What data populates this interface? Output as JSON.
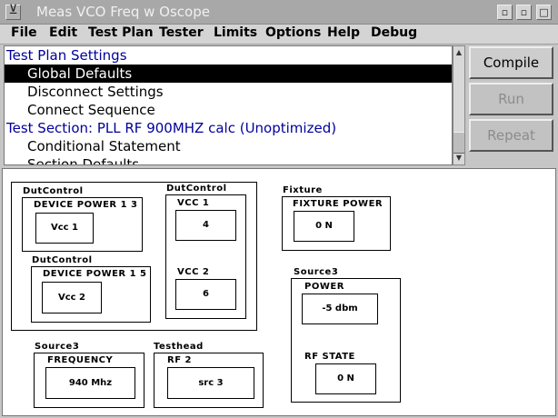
{
  "window": {
    "title": "Meas VCO Freq w Oscope",
    "sys_glyph": "⊻",
    "min_glyph": "▫",
    "max_glyph": "□"
  },
  "menubar": {
    "items": [
      "File",
      "Edit",
      "Test Plan",
      "Tester",
      "Limits",
      "Options",
      "Help",
      "Debug"
    ]
  },
  "tree": {
    "rows": [
      {
        "label": "Test Plan Settings",
        "kind": "head"
      },
      {
        "label": "Global Defaults",
        "kind": "child",
        "selected": true
      },
      {
        "label": "Disconnect Settings",
        "kind": "child"
      },
      {
        "label": "Connect Sequence",
        "kind": "child"
      },
      {
        "label": "Test Section: PLL RF 900MHZ calc (Unoptimized)",
        "kind": "head"
      },
      {
        "label": "Conditional Statement",
        "kind": "child"
      },
      {
        "label": "Section Defaults",
        "kind": "child"
      }
    ]
  },
  "buttons": {
    "compile": "Compile",
    "run": "Run",
    "repeat": "Repeat"
  },
  "scrollbar": {
    "up": "▲",
    "down": "▼"
  },
  "panels": {
    "dut1": {
      "group": "DutControl",
      "title": "DEVICE POWER 1 3",
      "value": "Vcc 1"
    },
    "dut2": {
      "group": "DutControl",
      "title": "DEVICE POWER 1 5",
      "value": "Vcc 2"
    },
    "dut3": {
      "group": "DutControl",
      "vcc1_title": "VCC 1",
      "vcc1_value": "4",
      "vcc2_title": "VCC 2",
      "vcc2_value": "6"
    },
    "fixture": {
      "group": "Fixture",
      "title": "FIXTURE POWER",
      "value": "0 N"
    },
    "source3_power": {
      "group": "Source3",
      "power_title": "POWER",
      "power_value": "-5  dbm",
      "rf_title": "RF STATE",
      "rf_value": "0 N"
    },
    "source3_freq": {
      "group": "Source3",
      "title": "FREQUENCY",
      "value": "940  Mhz"
    },
    "testhead": {
      "group": "Testhead",
      "title": "RF 2",
      "value": "src 3"
    }
  }
}
